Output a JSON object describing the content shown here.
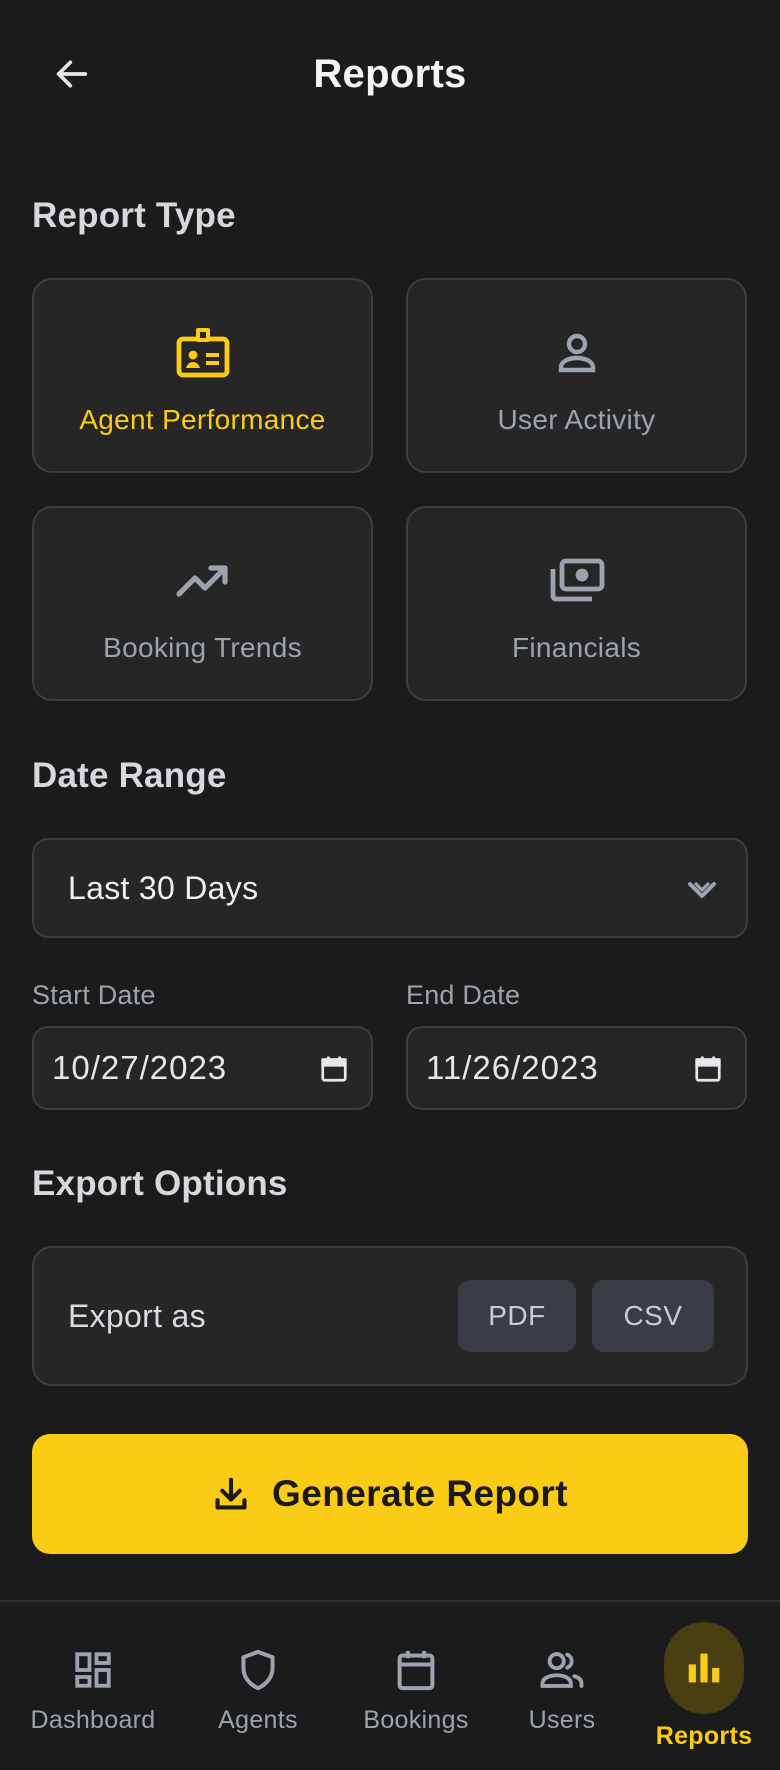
{
  "header": {
    "title": "Reports",
    "back_icon": "arrow-left-icon"
  },
  "report_type": {
    "section_title": "Report Type",
    "selected": "Agent Performance",
    "options": [
      {
        "label": "Agent Performance",
        "icon": "id-badge-icon",
        "active": true
      },
      {
        "label": "User Activity",
        "icon": "user-icon",
        "active": false
      },
      {
        "label": "Booking Trends",
        "icon": "trending-up-icon",
        "active": false
      },
      {
        "label": "Financials",
        "icon": "money-icon",
        "active": false
      }
    ]
  },
  "date_range": {
    "section_title": "Date Range",
    "selected_option": "Last 30 Days",
    "start_label": "Start Date",
    "start_value": "10/27/2023",
    "end_label": "End Date",
    "end_value": "11/26/2023"
  },
  "export": {
    "section_title": "Export Options",
    "label": "Export as",
    "formats": [
      "PDF",
      "CSV"
    ]
  },
  "generate": {
    "label": "Generate Report",
    "icon": "download-icon"
  },
  "bottom_nav": {
    "items": [
      {
        "label": "Dashboard",
        "icon": "dashboard-icon",
        "active": false
      },
      {
        "label": "Agents",
        "icon": "shield-icon",
        "active": false
      },
      {
        "label": "Bookings",
        "icon": "calendar-icon",
        "active": false
      },
      {
        "label": "Users",
        "icon": "users-icon",
        "active": false
      },
      {
        "label": "Reports",
        "icon": "bar-chart-icon",
        "active": true
      }
    ]
  },
  "colors": {
    "background": "#1b1b1c",
    "card": "#262627",
    "border": "#3a3e45",
    "accent": "#facc15",
    "muted_text": "#9ca3af"
  }
}
